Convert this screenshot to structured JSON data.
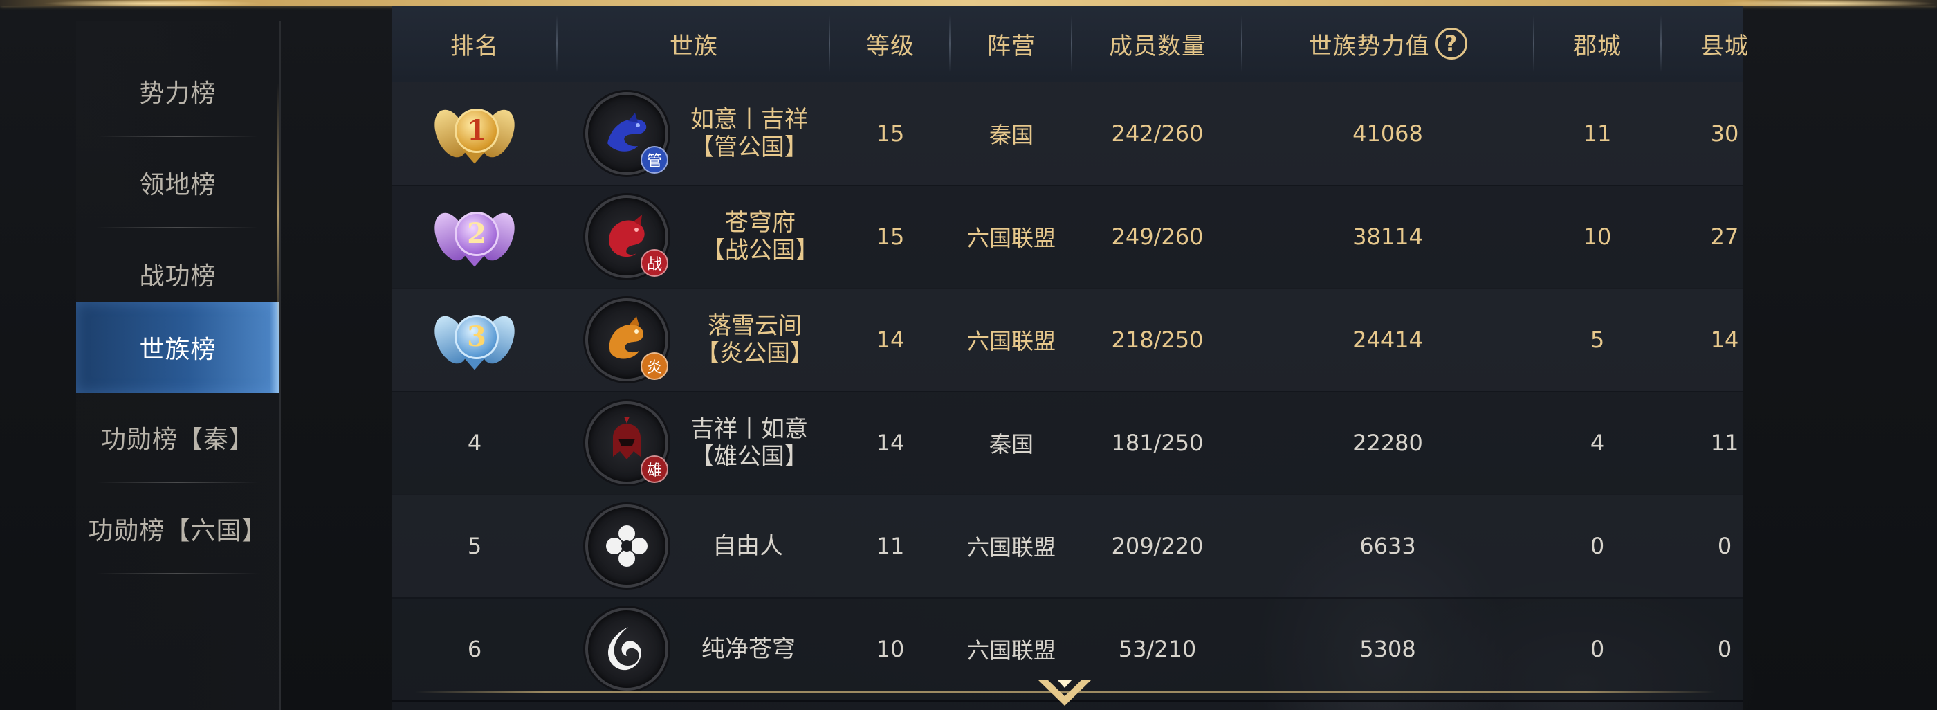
{
  "sidebar": {
    "items": [
      {
        "label": "势力榜",
        "active": false
      },
      {
        "label": "领地榜",
        "active": false
      },
      {
        "label": "战功榜",
        "active": false
      },
      {
        "label": "世族榜",
        "active": true
      },
      {
        "label": "功勋榜【秦】",
        "active": false
      },
      {
        "label": "功勋榜【六国】",
        "active": false
      }
    ]
  },
  "table": {
    "headers": {
      "rank": "排名",
      "clan": "世族",
      "level": "等级",
      "faction": "阵营",
      "members": "成员数量",
      "power": "世族势力值",
      "commandery": "郡城",
      "county": "县城"
    },
    "help_icon": "question-circle-icon",
    "rows": [
      {
        "rank": "1",
        "medal": "gold-medal-icon",
        "emblem": "blue-dragon-emblem",
        "badge": "管",
        "badge_color": "#2c4fb8",
        "name1": "如意丨吉祥",
        "name2": "【管公国】",
        "level": "15",
        "faction": "秦国",
        "members": "242/260",
        "power": "41068",
        "commandery": "11",
        "county": "30"
      },
      {
        "rank": "2",
        "medal": "purple-medal-icon",
        "emblem": "red-beast-emblem",
        "badge": "战",
        "badge_color": "#b3202a",
        "name1": "苍穹府",
        "name2": "【战公国】",
        "level": "15",
        "faction": "六国联盟",
        "members": "249/260",
        "power": "38114",
        "commandery": "10",
        "county": "27"
      },
      {
        "rank": "3",
        "medal": "blue-medal-icon",
        "emblem": "orange-dragon-emblem",
        "badge": "炎",
        "badge_color": "#d4741c",
        "name1": "落雪云间",
        "name2": "【炎公国】",
        "level": "14",
        "faction": "六国联盟",
        "members": "218/250",
        "power": "24414",
        "commandery": "5",
        "county": "14"
      },
      {
        "rank": "4",
        "medal": "",
        "emblem": "red-knight-emblem",
        "badge": "雄",
        "badge_color": "#9c1e22",
        "name1": "吉祥丨如意",
        "name2": "【雄公国】",
        "level": "14",
        "faction": "秦国",
        "members": "181/250",
        "power": "22280",
        "commandery": "4",
        "county": "11"
      },
      {
        "rank": "5",
        "medal": "",
        "emblem": "white-flower-emblem",
        "badge": "",
        "badge_color": "",
        "name1": "自由人",
        "name2": "",
        "level": "11",
        "faction": "六国联盟",
        "members": "209/220",
        "power": "6633",
        "commandery": "0",
        "county": "0"
      },
      {
        "rank": "6",
        "medal": "",
        "emblem": "white-swirl-emblem",
        "badge": "",
        "badge_color": "",
        "name1": "纯净苍穹",
        "name2": "",
        "level": "10",
        "faction": "六国联盟",
        "members": "53/210",
        "power": "5308",
        "commandery": "0",
        "county": "0"
      }
    ]
  },
  "scroll_icon": "chevron-down-icon",
  "colors": {
    "gold_text": "#e2c488",
    "active_tab": "#2a5a95",
    "body_text": "#d8d4cc"
  }
}
